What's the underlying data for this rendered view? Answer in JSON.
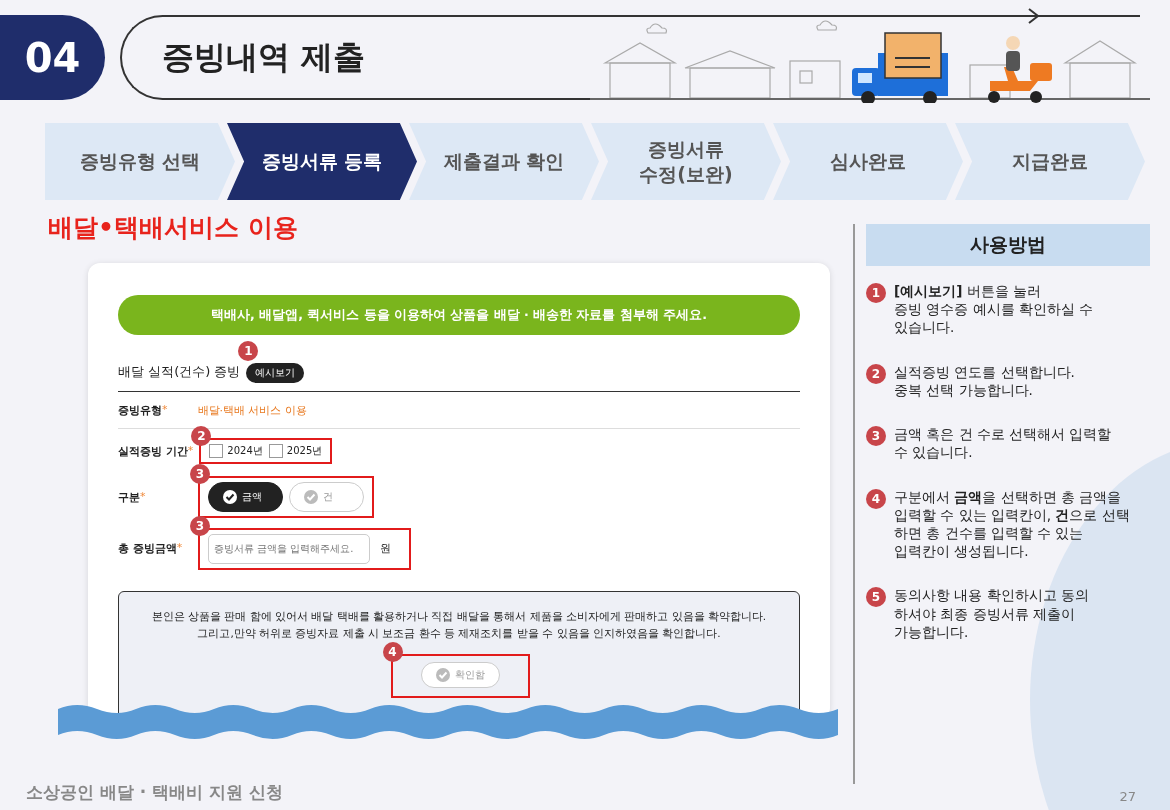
{
  "section": {
    "number": "04",
    "title": "증빙내역 제출"
  },
  "steps": [
    {
      "label": "증빙유형 선택",
      "selected": false
    },
    {
      "label": "증빙서류 등록",
      "selected": true
    },
    {
      "label": "제출결과 확인",
      "selected": false
    },
    {
      "label": "증빙서류\n수정(보완)",
      "selected": false
    },
    {
      "label": "심사완료",
      "selected": false
    },
    {
      "label": "지급완료",
      "selected": false
    }
  ],
  "subtitle": "배달•택배서비스 이용",
  "form": {
    "banner": "택배사, 배달앱, 퀵서비스 등을 이용하여 상품을 배달 · 배송한 자료를 첨부해 주세요.",
    "heading": "배달 실적(건수) 증빙",
    "example_button": "예시보기",
    "heading_marker": "1",
    "rows": [
      {
        "kind": "text",
        "label": "증빙유형",
        "required": "*",
        "value": "배달·택배 서비스 이용"
      },
      {
        "kind": "checkboxes",
        "label": "실적증빙 기간",
        "required": "*",
        "marker": "2",
        "options": [
          {
            "label": "2024년",
            "checked": false
          },
          {
            "label": "2025년",
            "checked": false
          }
        ]
      },
      {
        "kind": "toggle",
        "label": "구분",
        "required": "*",
        "marker": "3",
        "options": [
          {
            "label": "금액",
            "selected": true
          },
          {
            "label": "건",
            "selected": false
          }
        ]
      },
      {
        "kind": "input",
        "label": "총 증빙금액",
        "required": "*",
        "marker": "3",
        "placeholder": "증빙서류 금액을 입력해주세요.",
        "unit": "원"
      }
    ],
    "consent": {
      "lines": [
        "본인은 상품을 판매 함에 있어서 배달 택배를 활용하거나 직접 배달을 통해서 제품을 소비자에게 판매하고 있음을 확약합니다.",
        "그리고,만약 허위로 증빙자료 제출 시 보조금 환수 등 제재조치를 받을 수 있음을 인지하였음을 확인합니다."
      ],
      "button": "확인함",
      "checked": false,
      "marker": "4"
    }
  },
  "guide": {
    "title": "사용방법",
    "items": [
      {
        "number": "1",
        "text": "**[예시보기]** 버튼을 눌러\n증빙 영수증 예시를 확인하실 수\n있습니다."
      },
      {
        "number": "2",
        "text": "실적증빙 연도를 선택합니다.\n중복 선택 가능합니다."
      },
      {
        "number": "3",
        "text": "금액 혹은 건 수로 선택해서 입력할\n수 있습니다."
      },
      {
        "number": "4",
        "text": "구분에서 **금액**을 선택하면 총 금액을\n입력할 수 있는 입력칸이, **건**으로 선택\n하면 총 건수를 입력할 수 있는\n입력칸이 생성됩니다."
      },
      {
        "number": "5",
        "text": "동의사항 내용 확인하시고 동의\n하셔야 최종 증빙서류 제출이\n가능합니다."
      }
    ]
  },
  "footer": {
    "title": "소상공인 배달 · 택배비 지원 신청",
    "page": "27"
  }
}
